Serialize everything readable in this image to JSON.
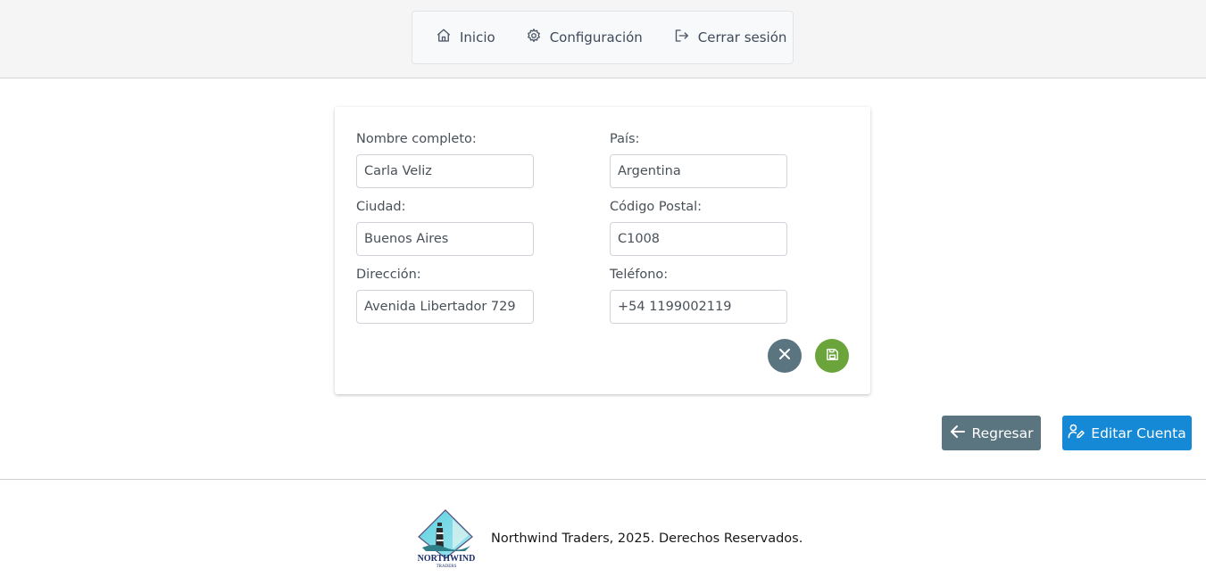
{
  "nav": {
    "items": [
      {
        "label": "Inicio",
        "icon": "home-icon"
      },
      {
        "label": "Configuración",
        "icon": "gear-icon"
      },
      {
        "label": "Cerrar sesión",
        "icon": "logout-icon"
      }
    ]
  },
  "form": {
    "nombre": {
      "label": "Nombre completo:",
      "value": "Carla Veliz"
    },
    "pais": {
      "label": "País:",
      "value": "Argentina"
    },
    "ciudad": {
      "label": "Ciudad:",
      "value": "Buenos Aires"
    },
    "codigo_postal": {
      "label": "Código Postal:",
      "value": "C1008"
    },
    "direccion": {
      "label": "Dirección:",
      "value": "Avenida Libertador 729"
    },
    "telefono": {
      "label": "Teléfono:",
      "value": "+54 1199002119"
    }
  },
  "actions": {
    "back_label": "Regresar",
    "edit_label": "Editar Cuenta"
  },
  "footer": {
    "logo_text": "NORTHWIND",
    "logo_subtext": "TRADERS",
    "text": "Northwind Traders, 2025. Derechos Reservados."
  },
  "colors": {
    "secondary": "#5b7580",
    "success": "#6aa43a",
    "primary": "#1589d6"
  }
}
